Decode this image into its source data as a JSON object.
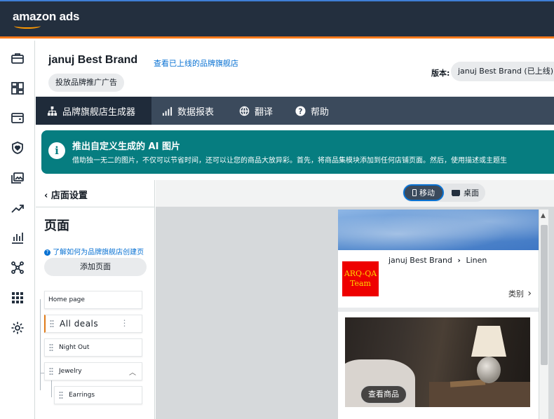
{
  "topbar": {
    "logo_text": "amazon ads"
  },
  "rail": {
    "icons": [
      "briefcase-icon",
      "dashboard-icon",
      "wallet-icon",
      "shield-heart-icon",
      "media-library-icon",
      "trend-icon",
      "bar-chart-icon",
      "network-icon",
      "apps-grid-icon",
      "settings-icon"
    ]
  },
  "header": {
    "brand_name": "januj Best Brand",
    "view_live_link": "查看已上线的品牌旗舰店",
    "promote_button": "投放品牌推广广告",
    "version_label": "版本:",
    "version_value": "januj Best Brand (已上线)"
  },
  "nav": {
    "tabs": [
      {
        "label": "品牌旗舰店生成器",
        "icon": "sitemap-icon"
      },
      {
        "label": "数据报表",
        "icon": "signal-bars-icon"
      },
      {
        "label": "翻译",
        "icon": "globe-icon"
      },
      {
        "label": "帮助",
        "icon": "help-icon"
      }
    ]
  },
  "banner": {
    "title": "推出自定义生成的 AI 图片",
    "description": "借助独一无二的图片，不仅可以节省时间，还可以让您的商品大放异彩。首先，将商品集模块添加到任何店铺页面。然后，使用描述或主题生"
  },
  "sidebar": {
    "back_label": "店面设置",
    "pages_title": "页面",
    "learn_link": "了解如何为品牌旗舰店创建页",
    "add_page_button": "添加页面",
    "pages": [
      {
        "label": "Home page"
      },
      {
        "label": "All deals"
      },
      {
        "label": "Night Out"
      },
      {
        "label": "Jewelry"
      },
      {
        "label": "Earrings"
      }
    ]
  },
  "preview": {
    "mobile_label": "移动",
    "desktop_label": "桌面",
    "brand_logo_text": "ARQ-QA Team",
    "breadcrumb_brand": "januj Best Brand",
    "breadcrumb_page": "Linen",
    "category_label": "类别",
    "view_products_button": "查看商品"
  }
}
